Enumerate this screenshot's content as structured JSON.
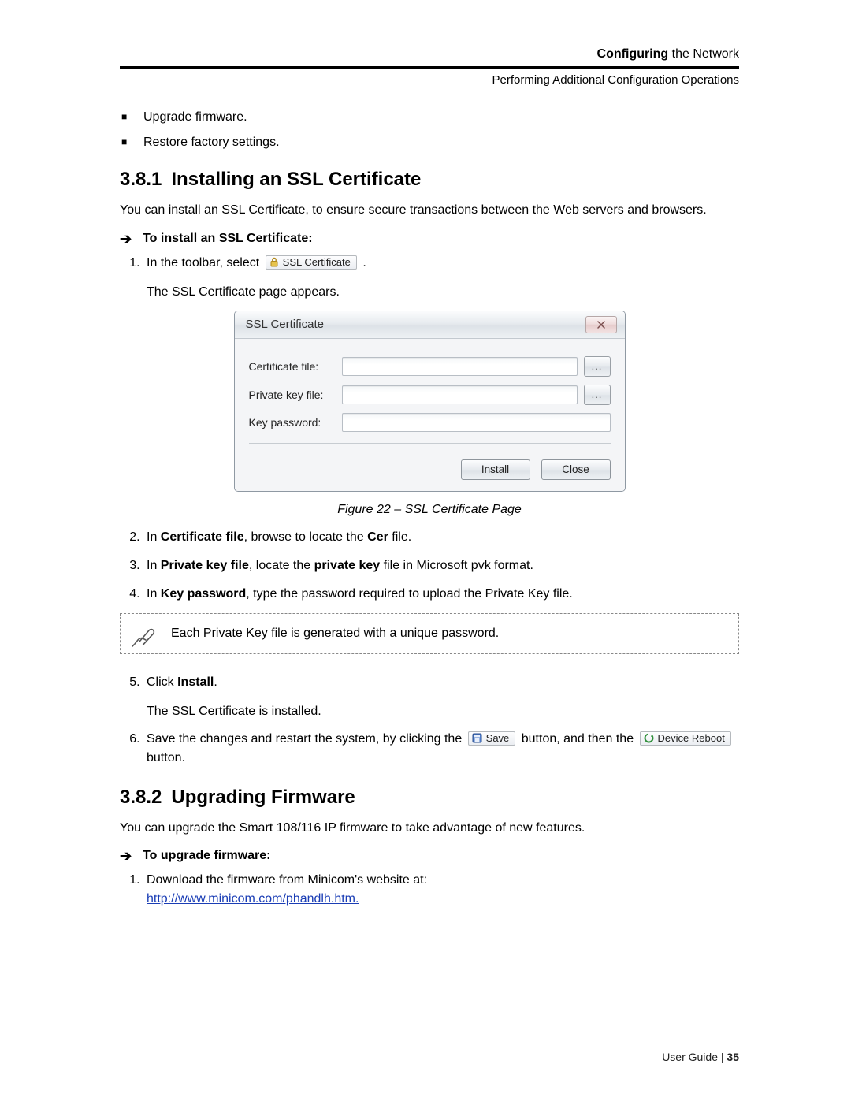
{
  "header": {
    "title_bold": "Configuring",
    "title_rest": " the Network",
    "subtitle": "Performing Additional Configuration Operations"
  },
  "pre_list": {
    "items": [
      "Upgrade firmware.",
      "Restore factory settings."
    ]
  },
  "sections": {
    "s1": {
      "num": "3.8.1",
      "title": "Installing an SSL Certificate"
    },
    "s2": {
      "num": "3.8.2",
      "title": "Upgrading Firmware"
    }
  },
  "paragraphs": {
    "p1": "You can install an SSL Certificate, to ensure secure transactions between the Web servers and browsers.",
    "p2": "The SSL Certificate page appears.",
    "p5": "The SSL Certificate is installed.",
    "p6": "You can upgrade the Smart 108/116 IP firmware to take advantage of new features."
  },
  "procedures": {
    "proc1": "To install an SSL Certificate:",
    "proc2": "To upgrade firmware:"
  },
  "step_texts": {
    "s1a": "In the toolbar, select ",
    "s1a_end": " .",
    "s2_pre": "In ",
    "s2_field": "Certificate file",
    "s2_mid": ", browse to locate the ",
    "s2_file": "Cer",
    "s2_end": " file.",
    "s3_pre": "In ",
    "s3_field": "Private key file",
    "s3_mid": ", locate the ",
    "s3_file": "private key",
    "s3_end": " file in Microsoft pvk format.",
    "s4_pre": "In ",
    "s4_field": "Key password",
    "s4_end": ", type the password required to upload the Private Key file.",
    "s5_pre": "Click ",
    "s5_btn": "Install",
    "s5_end": ".",
    "s6_pre": "Save the changes and restart the system, by clicking the ",
    "s6_mid": " button, and then the ",
    "s6_end": " button.",
    "fw1_pre": "Download the firmware from Minicom's website at: ",
    "fw1_link": "http://www.minicom.com/phandlh.htm."
  },
  "chips": {
    "ssl_cert": "SSL Certificate",
    "save": "Save",
    "device_reboot": "Device Reboot"
  },
  "dialog": {
    "title": "SSL Certificate",
    "labels": {
      "cert": "Certificate file:",
      "pkey": "Private key file:",
      "kpass": "Key password:"
    },
    "browse": "...",
    "buttons": {
      "install": "Install",
      "close": "Close"
    }
  },
  "figure_caption": "Figure 22 – SSL Certificate Page",
  "note_text": "Each Private Key file is generated with a unique password.",
  "footer": {
    "label": "User Guide",
    "sep": " | ",
    "page": "35"
  }
}
